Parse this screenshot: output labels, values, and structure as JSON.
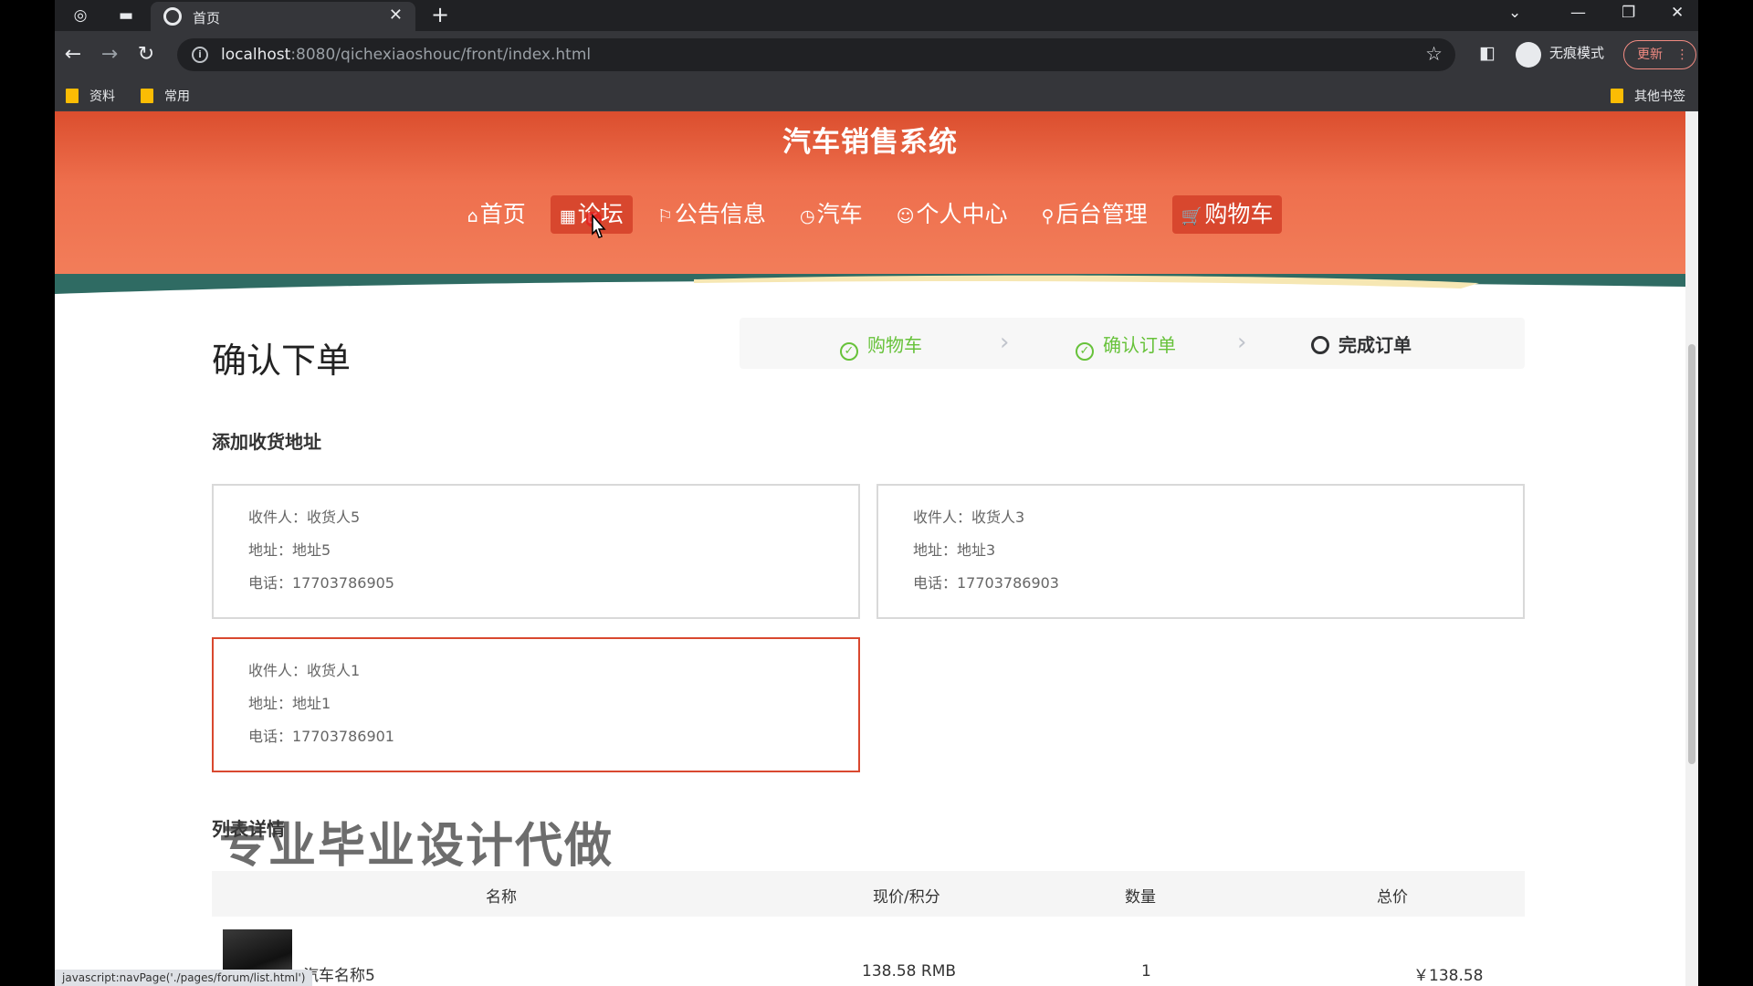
{
  "browser": {
    "tab_title": "首页",
    "url_host": "localhost",
    "url_path": ":8080/qichexiaoshouc/front/index.html",
    "incognito_label": "无痕模式",
    "update_label": "更新",
    "bookmarks": [
      "资料",
      "常用"
    ],
    "other_bookmarks": "其他书签",
    "status_url": "javascript:navPage('./pages/forum/list.html')"
  },
  "site": {
    "title": "汽车销售系统",
    "nav": [
      {
        "icon": "⌂",
        "label": "首页"
      },
      {
        "icon": "▦",
        "label": "论坛"
      },
      {
        "icon": "⚐",
        "label": "公告信息"
      },
      {
        "icon": "◷",
        "label": "汽车"
      },
      {
        "icon": "☺",
        "label": "个人中心"
      },
      {
        "icon": "⚲",
        "label": "后台管理"
      },
      {
        "icon": "🛒",
        "label": "购物车"
      }
    ]
  },
  "order": {
    "title": "确认下单",
    "steps": [
      {
        "label": "购物车",
        "state": "done"
      },
      {
        "label": "确认订单",
        "state": "done"
      },
      {
        "label": "完成订单",
        "state": "current"
      }
    ],
    "address_section_label": "添加收货地址",
    "addresses": [
      {
        "receiver": "收件人：收货人5",
        "address": "地址：地址5",
        "phone": "电话：17703786905",
        "selected": false
      },
      {
        "receiver": "收件人：收货人3",
        "address": "地址：地址3",
        "phone": "电话：17703786903",
        "selected": false
      },
      {
        "receiver": "收件人：收货人1",
        "address": "地址：地址1",
        "phone": "电话：17703786901",
        "selected": true
      }
    ],
    "list_section_label": "列表详情",
    "columns": [
      "名称",
      "现价/积分",
      "数量",
      "总价"
    ],
    "items": [
      {
        "name": "汽车名称5",
        "price": "138.58 RMB",
        "quantity": "1",
        "total": "￥138.58"
      }
    ]
  },
  "watermark": "专业毕业设计代做",
  "colors": {
    "accent": "#d9482f",
    "header": "#ee6f4d",
    "step_done": "#67c23a"
  }
}
